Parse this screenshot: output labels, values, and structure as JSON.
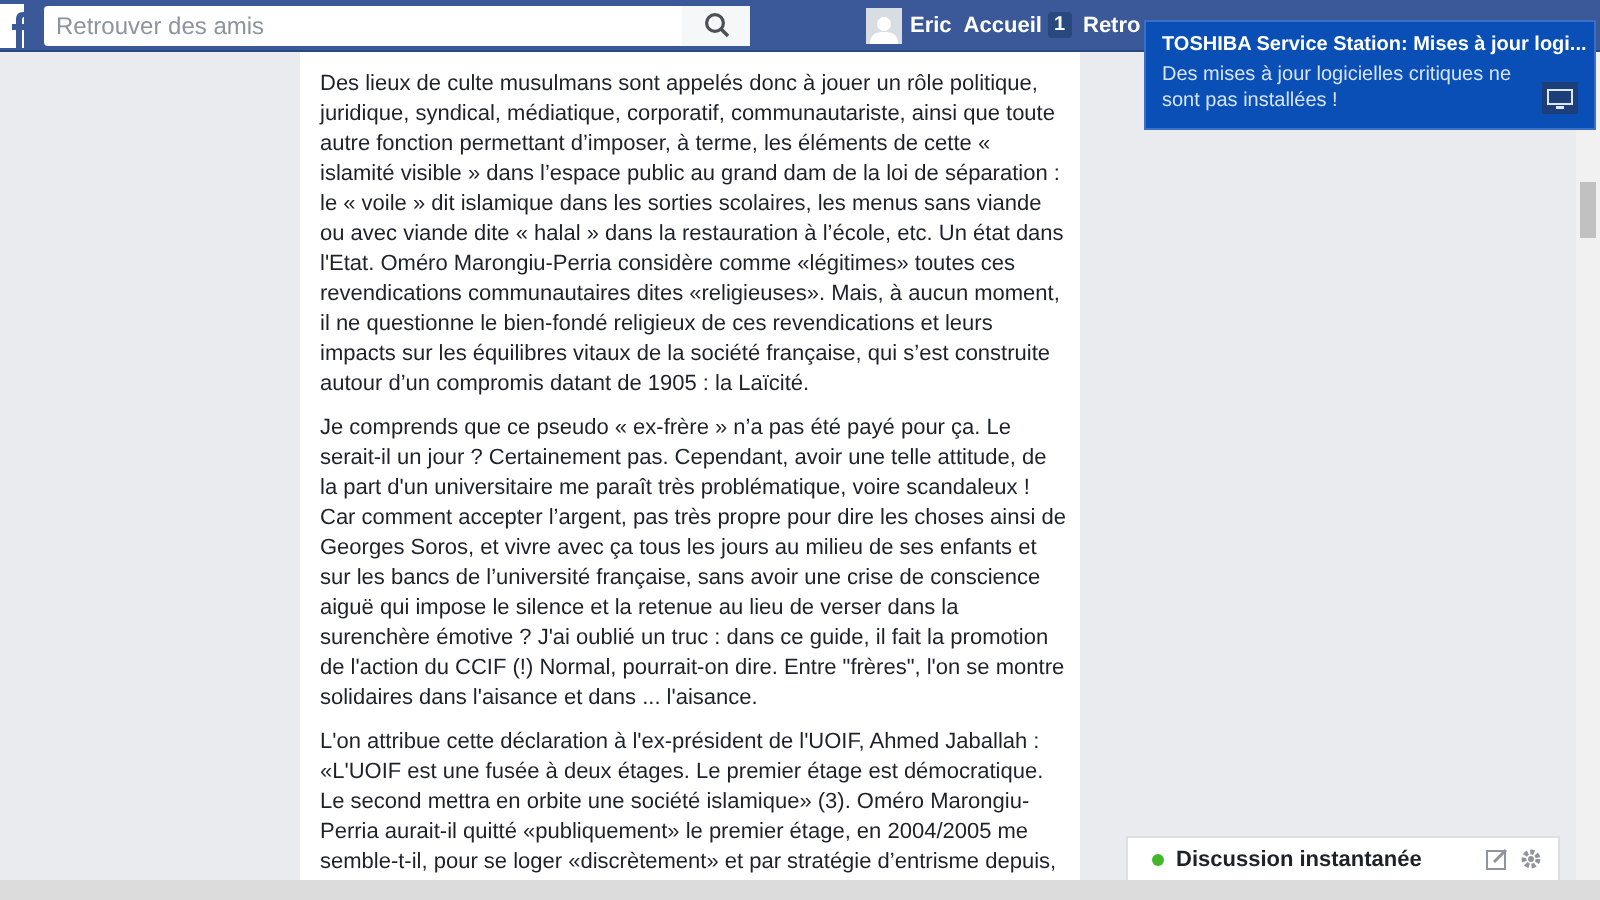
{
  "topbar": {
    "search": {
      "placeholder": "Retrouver des amis"
    },
    "user": "Eric",
    "nav": [
      {
        "label": "Accueil",
        "badge": "1"
      },
      {
        "label": "Retro"
      }
    ]
  },
  "post": {
    "paragraphs": [
      [
        "Des lieux de culte musulmans sont appelés donc à jouer un rôle politique,",
        "juridique, syndical, médiatique, corporatif, communautariste, ainsi que toute",
        "autre fonction permettant d’imposer, à terme, les éléments de cette «",
        "islamité visible » dans l’espace public au grand dam de la loi de séparation :",
        "le « voile » dit islamique dans les sorties scolaires, les menus sans viande",
        "ou avec viande dite « halal » dans la restauration à l’école, etc. Un état dans",
        "l'Etat. Oméro Marongiu-Perria considère comme «légitimes» toutes ces",
        "revendications communautaires dites «religieuses». Mais, à aucun moment,",
        "il ne questionne le bien-fondé religieux de ces revendications et leurs",
        "impacts sur les équilibres vitaux de la société française, qui s’est construite",
        "autour d’un compromis datant de 1905 : la Laïcité."
      ],
      [
        "Je comprends que ce pseudo « ex-frère » n’a pas été payé pour ça. Le",
        "serait-il un jour ? Certainement pas. Cependant, avoir une telle attitude, de",
        "la part d'un universitaire me paraît très problématique, voire scandaleux !",
        "Car comment accepter l’argent, pas très propre pour dire les choses ainsi de",
        "Georges Soros, et vivre avec ça tous les jours au milieu de ses enfants et",
        "sur les bancs de l’université française, sans avoir une crise de conscience",
        "aiguë qui impose le silence et la retenue au lieu de verser dans la",
        "surenchère émotive ? J'ai oublié un truc : dans ce guide, il fait la promotion",
        "de l'action du CCIF (!) Normal, pourrait-on dire. Entre \"frères\", l'on se montre",
        "solidaires dans l'aisance et dans ... l'aisance."
      ],
      [
        "L'on attribue cette déclaration à l'ex-président de l'UOIF, Ahmed Jaballah :",
        "«L'UOIF est une fusée à deux étages. Le premier étage est démocratique.",
        "Le second mettra en orbite une société islamique» (3). Oméro Marongiu-",
        "Perria aurait-il quitté «publiquement» le premier étage, en 2004/2005 me",
        "semble-t-il, pour se loger «discrètement» et par stratégie d’entrisme depuis,"
      ]
    ]
  },
  "notification": {
    "title": "TOSHIBA Service Station: Mises à jour logi...",
    "message": "Des mises à jour logicielles critiques ne sont pas installées !"
  },
  "chat": {
    "label": "Discussion instantanée",
    "online": true
  }
}
